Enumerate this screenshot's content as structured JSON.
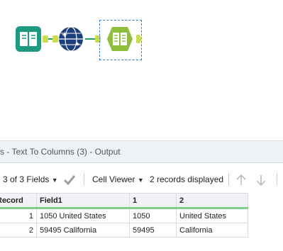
{
  "results_panel": {
    "title": "s - Text To Columns (3) - Output"
  },
  "toolbar": {
    "fields_label": "3 of 3 Fields",
    "cell_viewer_label": "Cell Viewer",
    "records_status": "2 records displayed"
  },
  "grid": {
    "columns": [
      "Record",
      "Field1",
      "1",
      "2"
    ],
    "rows": [
      {
        "record": "1",
        "field1": "1050 United States",
        "c1": "1050",
        "c2": "United States"
      },
      {
        "record": "2",
        "field1": "59495 California",
        "c1": "59495",
        "c2": "California"
      }
    ]
  },
  "colors": {
    "accent_green": "#2e9b6b",
    "anchor_yellow": "#c8dc4c",
    "selection_blue": "#3a7bd5",
    "header_underline": "#7fd08a"
  },
  "icons": {
    "input_tool": "book-icon",
    "regex_tool": "globe-sparkle-icon",
    "text_to_columns_tool": "text-to-columns-icon"
  }
}
